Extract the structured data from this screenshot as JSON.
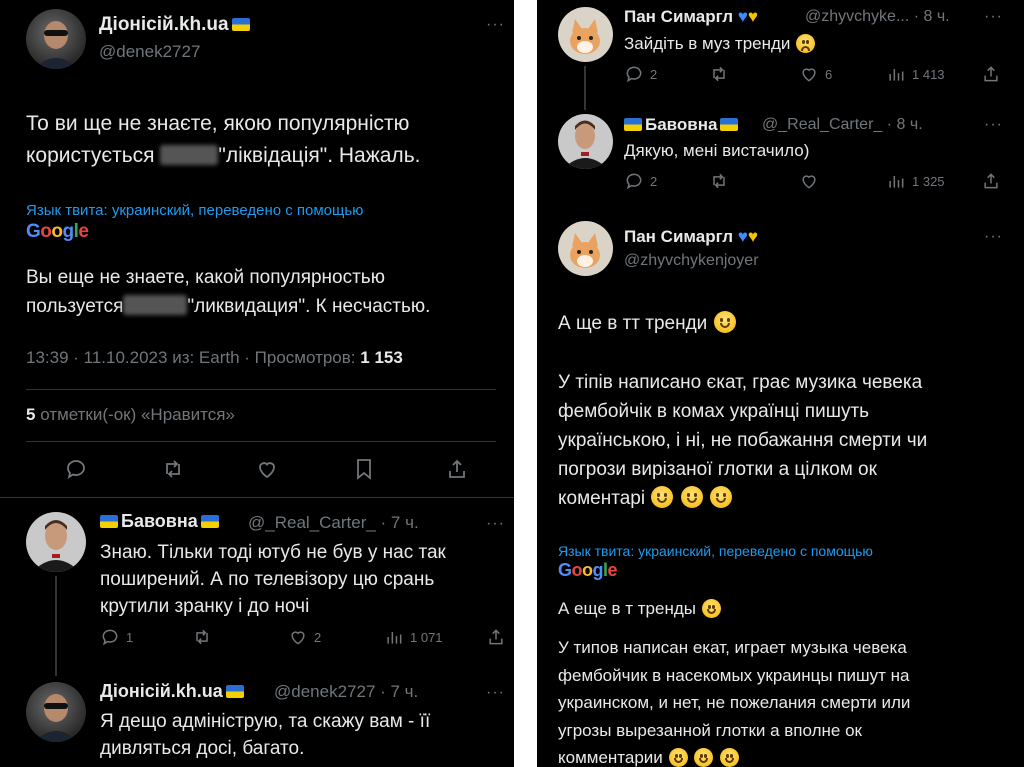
{
  "left": {
    "main_tweet": {
      "author_name": "Діонісій.kh.ua",
      "handle": "@denek2727",
      "text_line1": "То ви ще не знаєте, якою популярністю",
      "text_line2_a": "користується",
      "text_line2_b": "\"ліквідація\". Нажаль.",
      "translation_note": "Язык твита: украинский, переведено с помощью",
      "google": [
        "G",
        "o",
        "o",
        "g",
        "l",
        "e"
      ],
      "translated_line1": "Вы еще не знаете, какой популярностью",
      "translated_line2_a": "пользуется",
      "translated_line2_b": "\"ликвидация\". К несчастью.",
      "meta": "13:39 · 11.10.2023 из: Earth · Просмотров:",
      "views": "1 153",
      "likes_count": "5",
      "likes_label": "отметки(-ок) «Нравится»"
    },
    "reply1": {
      "author_name": "Бавовна",
      "handle": "@_Real_Carter_ · 7 ч.",
      "text": [
        "Знаю. Тільки тоді ютуб не був у нас так",
        "поширений. А по телевізору цю срань",
        "крутили зранку і до ночі"
      ],
      "replies": "1",
      "likes": "2",
      "views": "1 071"
    },
    "reply2": {
      "author_name": "Діонісій.kh.ua",
      "handle": "@denek2727 · 7 ч.",
      "text": [
        "Я дещо адмініструю, та скажу вам - її",
        "дивляться досі, багато."
      ]
    }
  },
  "right": {
    "tweet1": {
      "author_name": "Пан Симаргл",
      "handle": "@zhyvchyke... · 8 ч.",
      "text": "Зайдіть в муз тренди",
      "replies": "2",
      "likes": "6",
      "views": "1 413"
    },
    "tweet2": {
      "author_name": "Бавовна",
      "handle": "@_Real_Carter_ · 8 ч.",
      "text": "Дякую, мені вистачило)",
      "replies": "2",
      "views": "1 325"
    },
    "tweet3": {
      "author_name": "Пан Симаргл",
      "handle": "@zhyvchykenjoyer",
      "text_line1": "А ще в тт тренди",
      "body": [
        "У тіпів написано єкат, грає музика чевека",
        "фембойчік в комах українці пишуть",
        "українською, і ні, не побажання смерти чи",
        "погрози вирізаної глотки а цілком ок",
        "коментарі"
      ],
      "translation_note": "Язык твита: украинский, переведено с помощью",
      "google": [
        "G",
        "o",
        "o",
        "g",
        "l",
        "e"
      ],
      "translated_line1": "А еще в т тренды",
      "translated_body": [
        "У типов написан екат, играет музыка чевека",
        "фембойчик в насекомых украинцы пишут на",
        "украинском, и нет, не пожелания смерти или",
        "угрозы вырезанной глотки а вполне ок",
        "комментарии"
      ]
    }
  }
}
